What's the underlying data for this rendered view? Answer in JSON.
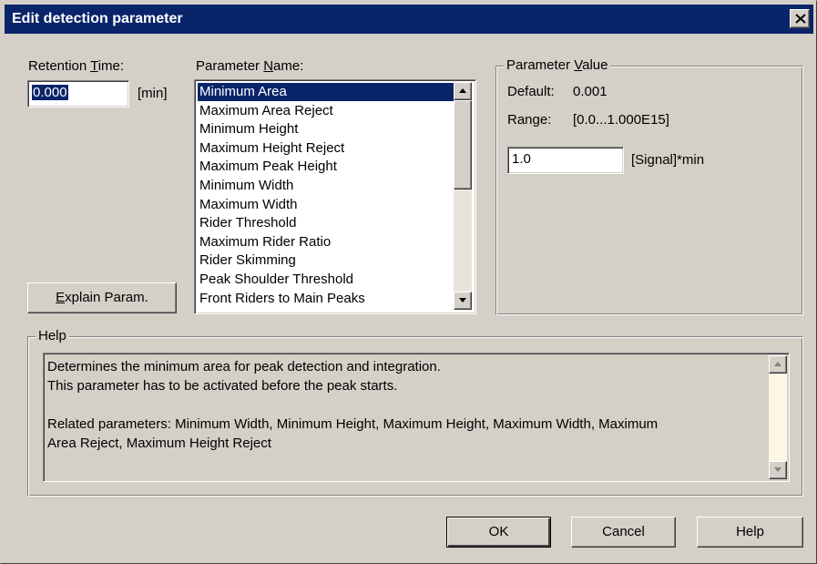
{
  "window": {
    "title": "Edit detection parameter",
    "close_icon": "close-icon"
  },
  "retention": {
    "label_prefix": "Retention ",
    "label_accel": "T",
    "label_suffix": "ime:",
    "value": "0.000",
    "unit": "[min]"
  },
  "parameter_name": {
    "label_prefix": "Parameter ",
    "label_accel": "N",
    "label_suffix": "ame:",
    "selected": "Minimum Area",
    "items": [
      "Minimum Area",
      "Maximum Area Reject",
      "Minimum Height",
      "Maximum Height Reject",
      "Maximum Peak Height",
      "Minimum Width",
      "Maximum Width",
      "Rider Threshold",
      "Maximum Rider Ratio",
      "Rider Skimming",
      "Peak Shoulder Threshold",
      "Front Riders to Main Peaks"
    ]
  },
  "explain_button": {
    "accel": "E",
    "rest": "xplain Param."
  },
  "parameter_value": {
    "group_prefix": "Parameter ",
    "group_accel": "V",
    "group_suffix": "alue",
    "default_label": "Default:",
    "default_value": "0.001",
    "range_label": "Range:",
    "range_value": "[0.0...1.000E15]",
    "value": "1.0",
    "unit": "[Signal]*min"
  },
  "help": {
    "group_title": "Help",
    "lines": [
      "Determines the minimum area for peak detection and integration.",
      "This parameter has to be activated before the peak starts.",
      "",
      "Related parameters: Minimum Width, Minimum Height, Maximum Height, Maximum Width, Maximum",
      "Area Reject, Maximum Height Reject"
    ]
  },
  "buttons": {
    "ok": "OK",
    "cancel": "Cancel",
    "help": "Help"
  },
  "colors": {
    "titlebar": "#0a246a",
    "face": "#d4d0c8",
    "selection": "#0a246a"
  }
}
